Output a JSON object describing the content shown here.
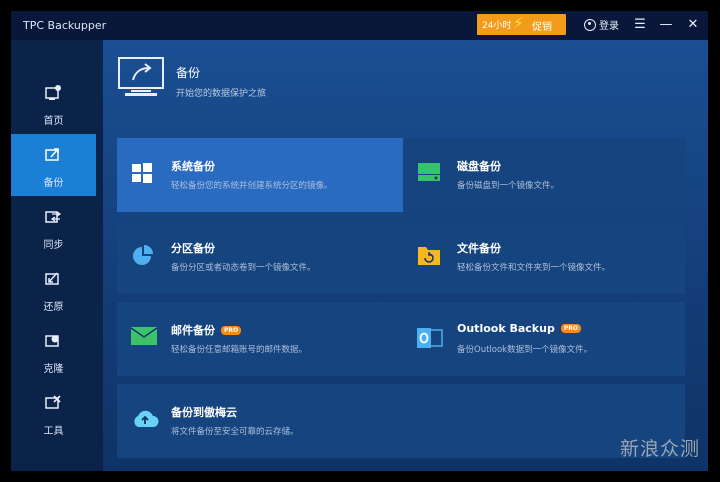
{
  "titlebar": {
    "app_title": "TPC Backupper",
    "promo_left": "24小时",
    "promo_right": "促销",
    "login_label": "登录",
    "menu_icon": "menu-icon",
    "minimize_icon": "minimize-icon",
    "close_icon": "close-icon"
  },
  "sidebar": {
    "items": [
      {
        "label": "首页",
        "icon": "home-icon"
      },
      {
        "label": "备份",
        "icon": "backup-icon",
        "active": true
      },
      {
        "label": "同步",
        "icon": "sync-icon"
      },
      {
        "label": "还原",
        "icon": "restore-icon"
      },
      {
        "label": "克隆",
        "icon": "clone-icon"
      },
      {
        "label": "工具",
        "icon": "tools-icon"
      }
    ]
  },
  "header": {
    "title": "备份",
    "subtitle": "开始您的数据保护之旅"
  },
  "cards": [
    {
      "title": "系统备份",
      "desc": "轻松备份您的系统并创建系统分区的镜像。",
      "icon": "windows-icon"
    },
    {
      "title": "磁盘备份",
      "desc": "备份磁盘到一个镜像文件。",
      "icon": "disk-icon"
    },
    {
      "title": "分区备份",
      "desc": "备份分区或者动态卷到一个镜像文件。",
      "icon": "partition-icon"
    },
    {
      "title": "文件备份",
      "desc": "轻松备份文件和文件夹到一个镜像文件。",
      "icon": "folder-icon"
    },
    {
      "title": "邮件备份",
      "desc": "轻松备份任意邮箱账号的邮件数据。",
      "icon": "mail-icon",
      "badge": "PRO"
    },
    {
      "title": "Outlook Backup",
      "desc": "备份Outlook数据到一个镜像文件。",
      "icon": "outlook-icon",
      "badge": "PRO"
    },
    {
      "title": "备份到傲梅云",
      "desc": "将文件备份至安全可靠的云存储。",
      "icon": "cloud-icon"
    }
  ],
  "watermark": "新浪众测",
  "colors": {
    "accent": "#1b7fd5",
    "promo": "#f39c1c",
    "pro_badge": "#f58a1f"
  }
}
